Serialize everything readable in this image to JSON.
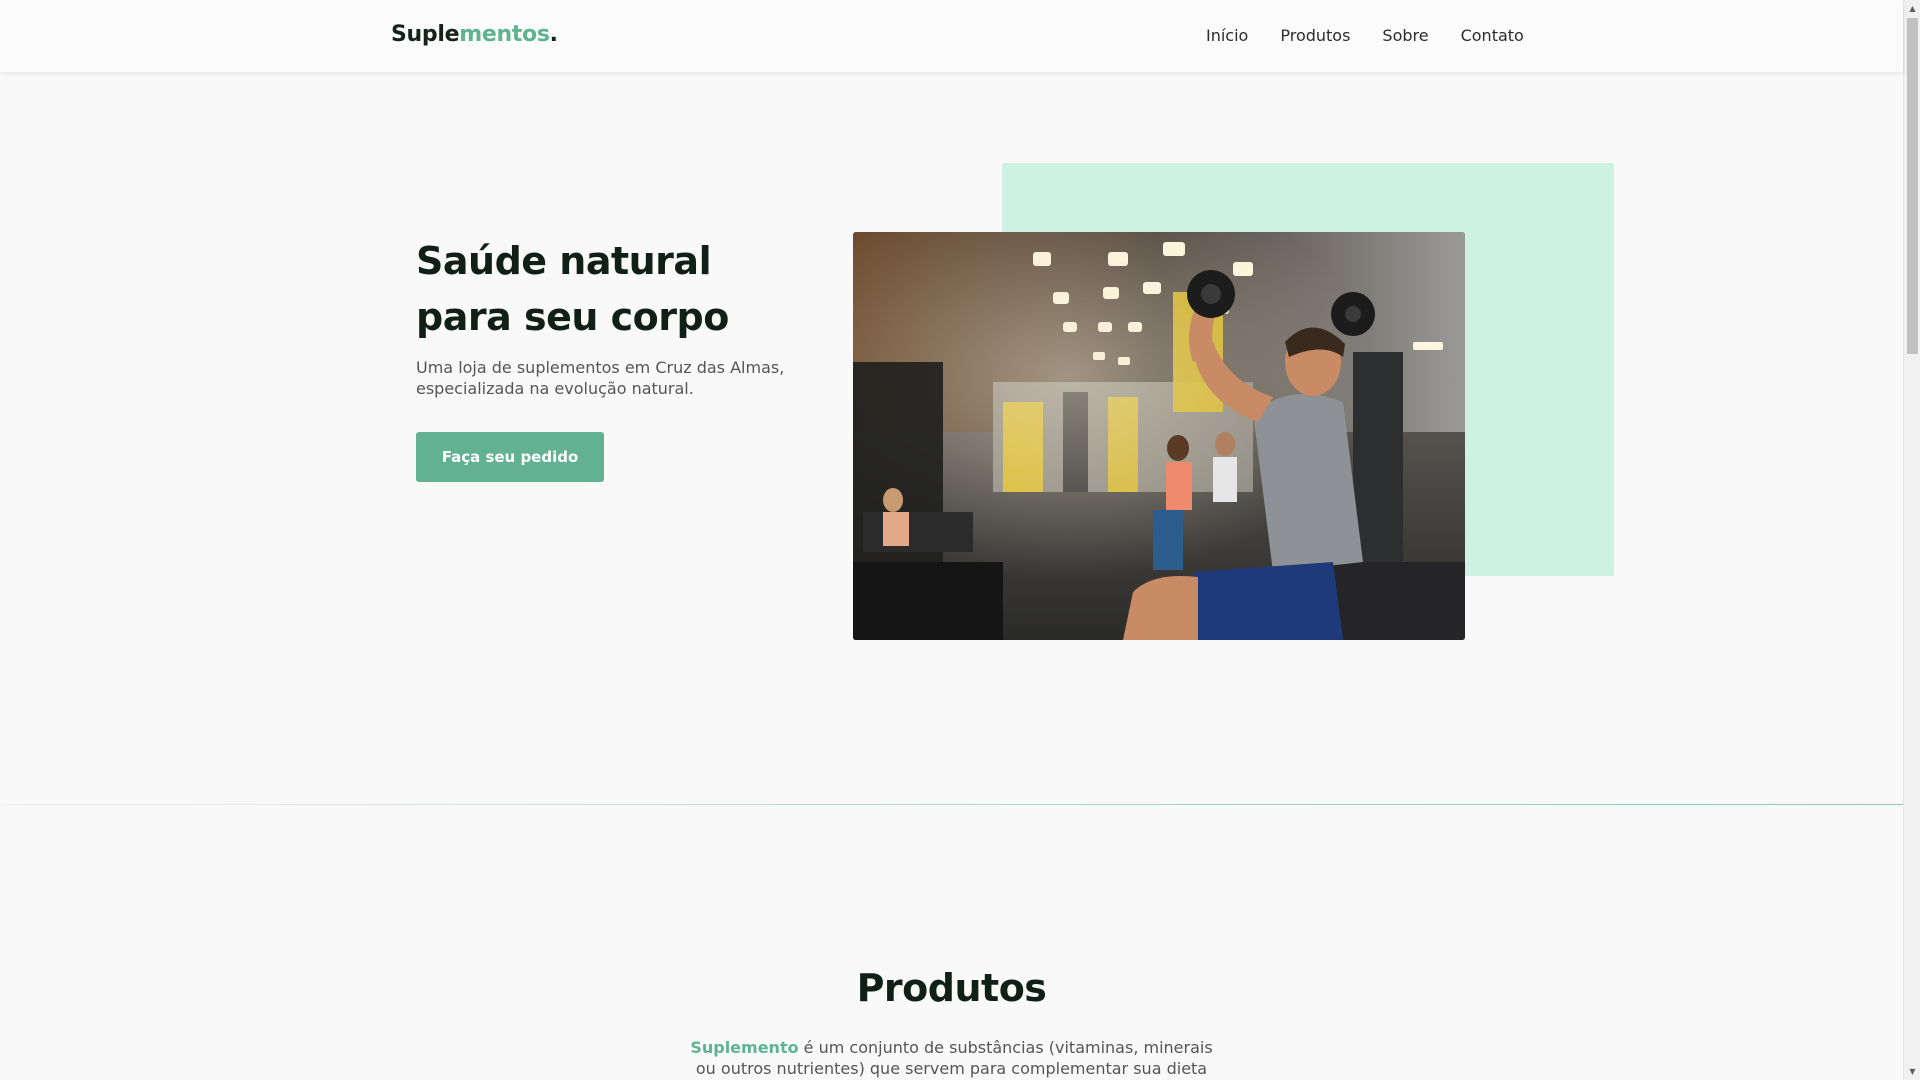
{
  "header": {
    "logo_part1": "Suple",
    "logo_part2": "mentos",
    "logo_dot": ".",
    "nav": [
      "Início",
      "Produtos",
      "Sobre",
      "Contato"
    ]
  },
  "hero": {
    "title": "Saúde natural para seu corpo",
    "description": "Uma loja de suplementos em Cruz das Almas, especializada na evolução natural.",
    "button_label": "Faça seu pedido",
    "image_alt": "gym-photo"
  },
  "products": {
    "title": "Produtos",
    "desc_highlight": "Suplemento",
    "desc_rest": " é um conjunto de substâncias (vitaminas, minerais ou outros nutrientes) que servem para complementar sua dieta quando"
  },
  "colors": {
    "accent": "#5eb391",
    "button": "#62b193",
    "mint_box": "#cdf2e4",
    "text_dark": "#102018"
  },
  "icons": {
    "scroll_up": "triangle-up-icon",
    "scroll_down": "triangle-down-icon"
  }
}
